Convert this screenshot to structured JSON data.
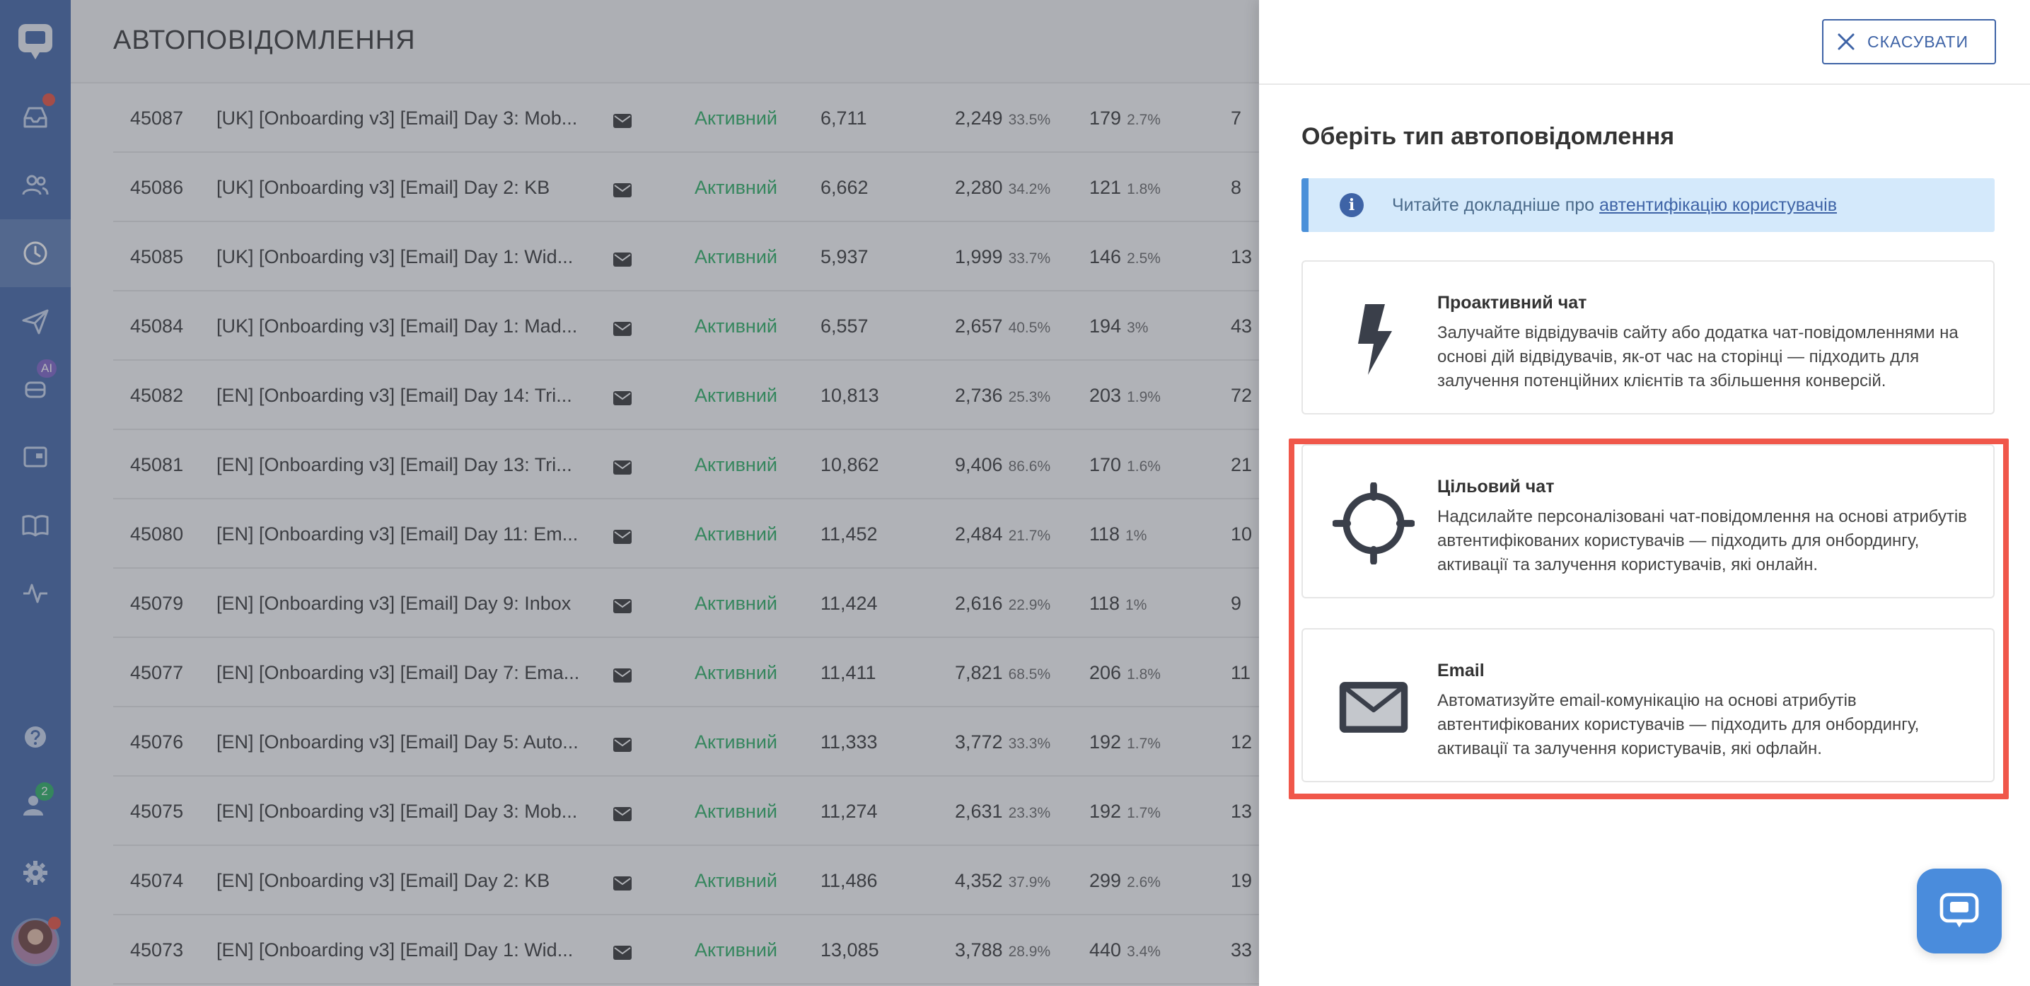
{
  "main": {
    "title": "АВТОПОВІДОМЛЕННЯ",
    "rows": [
      {
        "id": "45087",
        "name": "[UK] [Onboarding v3] [Email] Day 3: Mob...",
        "status": "Активний",
        "sent": "6,711",
        "opened": "2,249",
        "opened_pct": "33.5%",
        "clicked": "179",
        "clicked_pct": "2.7%",
        "extra": "7"
      },
      {
        "id": "45086",
        "name": "[UK] [Onboarding v3] [Email] Day 2: KB",
        "status": "Активний",
        "sent": "6,662",
        "opened": "2,280",
        "opened_pct": "34.2%",
        "clicked": "121",
        "clicked_pct": "1.8%",
        "extra": "8"
      },
      {
        "id": "45085",
        "name": "[UK] [Onboarding v3] [Email] Day 1: Wid...",
        "status": "Активний",
        "sent": "5,937",
        "opened": "1,999",
        "opened_pct": "33.7%",
        "clicked": "146",
        "clicked_pct": "2.5%",
        "extra": "13"
      },
      {
        "id": "45084",
        "name": "[UK] [Onboarding v3] [Email] Day 1: Mad...",
        "status": "Активний",
        "sent": "6,557",
        "opened": "2,657",
        "opened_pct": "40.5%",
        "clicked": "194",
        "clicked_pct": "3%",
        "extra": "43"
      },
      {
        "id": "45082",
        "name": "[EN] [Onboarding v3] [Email] Day 14: Tri...",
        "status": "Активний",
        "sent": "10,813",
        "opened": "2,736",
        "opened_pct": "25.3%",
        "clicked": "203",
        "clicked_pct": "1.9%",
        "extra": "72"
      },
      {
        "id": "45081",
        "name": "[EN] [Onboarding v3] [Email] Day 13: Tri...",
        "status": "Активний",
        "sent": "10,862",
        "opened": "9,406",
        "opened_pct": "86.6%",
        "clicked": "170",
        "clicked_pct": "1.6%",
        "extra": "21"
      },
      {
        "id": "45080",
        "name": "[EN] [Onboarding v3] [Email] Day 11: Em...",
        "status": "Активний",
        "sent": "11,452",
        "opened": "2,484",
        "opened_pct": "21.7%",
        "clicked": "118",
        "clicked_pct": "1%",
        "extra": "10"
      },
      {
        "id": "45079",
        "name": "[EN] [Onboarding v3] [Email] Day 9: Inbox",
        "status": "Активний",
        "sent": "11,424",
        "opened": "2,616",
        "opened_pct": "22.9%",
        "clicked": "118",
        "clicked_pct": "1%",
        "extra": "9"
      },
      {
        "id": "45077",
        "name": "[EN] [Onboarding v3] [Email] Day 7: Ema...",
        "status": "Активний",
        "sent": "11,411",
        "opened": "7,821",
        "opened_pct": "68.5%",
        "clicked": "206",
        "clicked_pct": "1.8%",
        "extra": "11"
      },
      {
        "id": "45076",
        "name": "[EN] [Onboarding v3] [Email] Day 5: Auto...",
        "status": "Активний",
        "sent": "11,333",
        "opened": "3,772",
        "opened_pct": "33.3%",
        "clicked": "192",
        "clicked_pct": "1.7%",
        "extra": "12"
      },
      {
        "id": "45075",
        "name": "[EN] [Onboarding v3] [Email] Day 3: Mob...",
        "status": "Активний",
        "sent": "11,274",
        "opened": "2,631",
        "opened_pct": "23.3%",
        "clicked": "192",
        "clicked_pct": "1.7%",
        "extra": "13"
      },
      {
        "id": "45074",
        "name": "[EN] [Onboarding v3] [Email] Day 2: KB",
        "status": "Активний",
        "sent": "11,486",
        "opened": "4,352",
        "opened_pct": "37.9%",
        "clicked": "299",
        "clicked_pct": "2.6%",
        "extra": "19"
      },
      {
        "id": "45073",
        "name": "[EN] [Onboarding v3] [Email] Day 1: Wid...",
        "status": "Активний",
        "sent": "13,085",
        "opened": "3,788",
        "opened_pct": "28.9%",
        "clicked": "440",
        "clicked_pct": "3.4%",
        "extra": "33"
      }
    ]
  },
  "sidebar": {
    "ai_badge": "AI",
    "users_badge": "2",
    "items": [
      "inbox-icon",
      "contacts-icon",
      "clock-icon",
      "send-icon",
      "bot-icon",
      "window-icon",
      "book-icon",
      "pulse-icon",
      "help-icon",
      "team-icon",
      "settings-icon"
    ]
  },
  "panel": {
    "cancel_label": "СКАСУВАТИ",
    "heading": "Оберіть тип автоповідомлення",
    "info_text": "Читайте докладніше про ",
    "info_link": "автентифікацію користувачів",
    "cards": [
      {
        "title": "Проактивний чат",
        "description": "Залучайте відвідувачів сайту або додатка чат-повідомленнями на основі дій відвідувачів, як-от час на сторінці — підходить для залучення потенційних клієнтів та збільшення конверсій."
      },
      {
        "title": "Цільовий чат",
        "description": "Надсилайте персоналізовані чат-повідомлення на основі атрибутів автентифікованих користувачів — підходить для онбордингу, активації та залучення користувачів, які онлайн."
      },
      {
        "title": "Email",
        "description": "Автоматизуйте email-комунікацію на основі атрибутів автентифікованих користувачів — підходить для онбордингу, активації та залучення користувачів, які офлайн."
      }
    ]
  },
  "colors": {
    "sidebar": "#3e63a6",
    "accent": "#3e63a6",
    "status_active": "#27ae60",
    "highlight": "#f0574a",
    "info_bg": "#d4e9fb"
  }
}
